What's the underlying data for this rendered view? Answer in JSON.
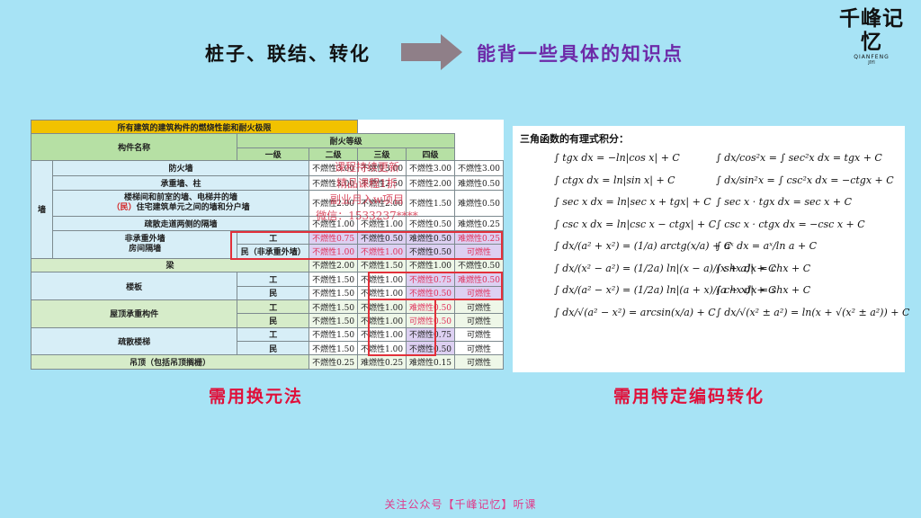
{
  "logo": {
    "main": "千峰记忆",
    "sub": "QIANFENG",
    "sub2": "JIYI"
  },
  "heading": {
    "left": "桩子、联结、转化",
    "right": "能背一些具体的知识点"
  },
  "colors": {
    "accent_purple": "#6d2aa8",
    "caption_red": "#e0103a",
    "background": "#a7e3f5",
    "arrow": "#8f7f88"
  },
  "table": {
    "title": "所有建筑的建筑构件的燃烧性能和耐火极限",
    "col_name": "构件名称",
    "fire_grade": "耐火等级",
    "grades": [
      "一级",
      "二级",
      "三级",
      "四级"
    ],
    "wall_label": "墙",
    "rows": [
      {
        "name": "防火墙",
        "v": [
          "不燃性3.00",
          "不燃性3.00",
          "不燃性3.00",
          "不燃性3.00"
        ]
      },
      {
        "name": "承重墙、柱",
        "v": [
          "不燃性3.00",
          "不燃性2.50",
          "不燃性2.00",
          "难燃性0.50"
        ]
      },
      {
        "name_line1": "楼梯间和前室的墙、电梯井的墙",
        "name_prefix": "（民）",
        "name_line2": "住宅建筑单元之间的墙和分户墙",
        "v": [
          "不燃性2.00",
          "不燃性2.00",
          "不燃性1.50",
          "难燃性0.50"
        ]
      },
      {
        "name": "疏散走道两侧的隔墙",
        "v": [
          "不燃性1.00",
          "不燃性1.00",
          "不燃性0.50",
          "难燃性0.25"
        ]
      }
    ],
    "nonbearing": {
      "label_line1": "非承重外墙",
      "label_line2": "房间隔墙",
      "work_label": "工",
      "civil_label": "民（非承重外墙）",
      "work": [
        "不燃性0.75",
        "不燃性0.50",
        "难燃性0.50",
        "难燃性0.25"
      ],
      "civil": [
        "不燃性1.00",
        "不燃性1.00",
        "不燃性0.50",
        "可燃性"
      ]
    },
    "beam": {
      "name": "梁",
      "v": [
        "不燃性2.00",
        "不燃性1.50",
        "不燃性1.00",
        "不燃性0.50"
      ]
    },
    "floor": {
      "name": "楼板",
      "work_label": "工",
      "civil_label": "民",
      "work": [
        "不燃性1.50",
        "不燃性1.00",
        "不燃性0.75",
        "难燃性0.50"
      ],
      "civil": [
        "不燃性1.50",
        "不燃性1.00",
        "不燃性0.50",
        "可燃性"
      ]
    },
    "roof": {
      "name": "屋顶承重构件",
      "work_label": "工",
      "civil_label": "民",
      "work": [
        "不燃性1.50",
        "不燃性1.00",
        "难燃性0.50",
        "可燃性"
      ],
      "civil": [
        "不燃性1.50",
        "不燃性1.00",
        "可燃性0.50",
        "可燃性"
      ]
    },
    "stairs": {
      "name": "疏散楼梯",
      "work_label": "工",
      "civil_label": "民",
      "work": [
        "不燃性1.50",
        "不燃性1.00",
        "不燃性0.75",
        "可燃性"
      ],
      "civil": [
        "不燃性1.50",
        "不燃性1.00",
        "不燃性0.50",
        "可燃性"
      ]
    },
    "ceiling": {
      "name": "吊顶（包括吊顶搁栅）",
      "v": [
        "不燃性0.25",
        "难燃性0.25",
        "难燃性0.15",
        "可燃性"
      ]
    },
    "watermark": [
      "课程持续更新",
      "精品课程1折",
      "副业月入w项目",
      "微信：1533237****"
    ]
  },
  "formulas": {
    "title": "三角函数的有理式积分：",
    "left": [
      "∫ tgx dx = −ln|cos x| + C",
      "∫ ctgx dx = ln|sin x| + C",
      "∫ sec x dx = ln|sec x + tgx| + C",
      "∫ csc x dx = ln|csc x − ctgx| + C",
      "∫ dx/(a² + x²) = (1/a) arctg(x/a) + C",
      "∫ dx/(x² − a²) = (1/2a) ln|(x − a)/(x + a)| + C",
      "∫ dx/(a² − x²) = (1/2a) ln|(a + x)/(a − x)| + C",
      "∫ dx/√(a² − x²) = arcsin(x/a) + C"
    ],
    "right": [
      "∫ dx/cos²x = ∫ sec²x dx = tgx + C",
      "∫ dx/sin²x = ∫ csc²x dx = −ctgx + C",
      "∫ sec x · tgx dx = sec x + C",
      "∫ csc x · ctgx dx = −csc x + C",
      "∫ aˣ dx = aˣ/ln a + C",
      "∫ shx dx = chx + C",
      "∫ chx dx = shx + C",
      "∫ dx/√(x² ± a²) = ln(x + √(x² ± a²)) + C"
    ]
  },
  "captions": {
    "left": "需用换元法",
    "right": "需用特定编码转化"
  },
  "footer": "关注公众号【千峰记忆】听课"
}
